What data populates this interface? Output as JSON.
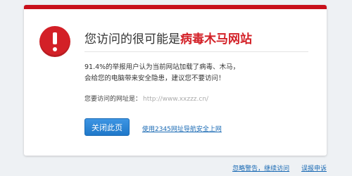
{
  "warning": {
    "title_prefix": "您访问的很可能是",
    "title_danger": "病毒木马网站",
    "description_line1": "91.4%的举报用户认为当前网站加载了病毒、木马，",
    "description_line2": "会给您的电脑带来安全隐患，建议您不要访问！",
    "url_label": "您要访问的网址是：",
    "url_value": "http://www.xxzzz.cn/"
  },
  "actions": {
    "close_button": "关闭此页",
    "nav_link": "使用2345网址导航安全上网"
  },
  "footer": {
    "ignore_link": "忽略警告，继续访问",
    "report_link": "误报申诉"
  },
  "colors": {
    "danger": "#d32027",
    "accent_bar": "#c8101b",
    "button": "#2a86d6",
    "link": "#1a6ab4"
  }
}
